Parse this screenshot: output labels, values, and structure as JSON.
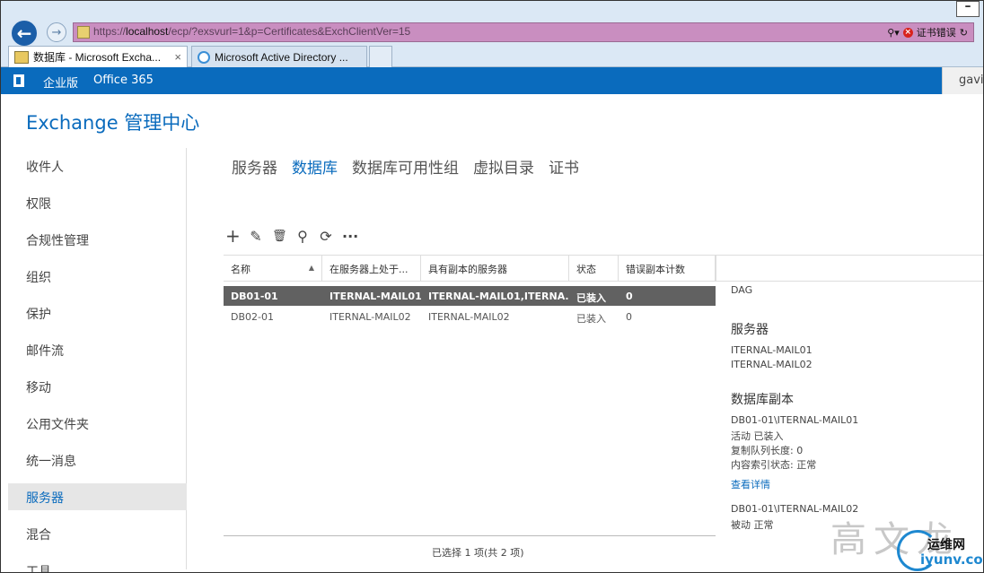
{
  "browser": {
    "url_prefix": "https://",
    "url_host": "localhost",
    "url_path": "/ecp/?exsvurl=1&p=Certificates&ExchClientVer=15",
    "cert_error": "证书错误",
    "tabs": [
      {
        "title": "数据库 - Microsoft Excha...",
        "close": "×"
      },
      {
        "title": "Microsoft Active Directory ..."
      }
    ]
  },
  "suitebar": {
    "edition": "企业版",
    "office": "Office 365",
    "user": "gavin"
  },
  "app_title": "Exchange 管理中心",
  "nav": {
    "items": [
      {
        "label": "收件人"
      },
      {
        "label": "权限"
      },
      {
        "label": "合规性管理"
      },
      {
        "label": "组织"
      },
      {
        "label": "保护"
      },
      {
        "label": "邮件流"
      },
      {
        "label": "移动"
      },
      {
        "label": "公用文件夹"
      },
      {
        "label": "统一消息"
      },
      {
        "label": "服务器",
        "selected": true
      },
      {
        "label": "混合"
      },
      {
        "label": "工具"
      }
    ]
  },
  "tabs": [
    "服务器",
    "数据库",
    "数据库可用性组",
    "虚拟目录",
    "证书"
  ],
  "selected_tab": "数据库",
  "toolbar": {
    "add": "+",
    "edit": "✎",
    "delete": "🗑",
    "search": "⚲",
    "refresh": "⟳",
    "more": "···"
  },
  "grid": {
    "columns": [
      "名称",
      "在服务器上处于...",
      "具有副本的服务器",
      "状态",
      "错误副本计数"
    ],
    "sort_arrow": "▲",
    "rows": [
      {
        "name": "DB01-01",
        "server": "ITERNAL-MAIL01",
        "copies": "ITERNAL-MAIL01,ITERNA...",
        "status": "已装入",
        "bad": "0",
        "selected": true
      },
      {
        "name": "DB02-01",
        "server": "ITERNAL-MAIL02",
        "copies": "ITERNAL-MAIL02",
        "status": "已装入",
        "bad": "0"
      }
    ],
    "footer": "已选择 1 项(共 2 项)"
  },
  "details": {
    "dag": "DAG",
    "servers_heading": "服务器",
    "servers": [
      "ITERNAL-MAIL01",
      "ITERNAL-MAIL02"
    ],
    "copies_heading": "数据库副本",
    "copy1_name": "DB01-01\\ITERNAL-MAIL01",
    "copy1_state": "活动 已装入",
    "copy1_queue": "复制队列长度: 0",
    "copy1_index": "内容索引状态: 正常",
    "view_details": "查看详情",
    "copy2_name": "DB01-01\\ITERNAL-MAIL02",
    "copy2_state": "被动 正常"
  },
  "watermark": {
    "chars": "高文龙",
    "brand": "运维网",
    "domain": "iyunv.com"
  }
}
